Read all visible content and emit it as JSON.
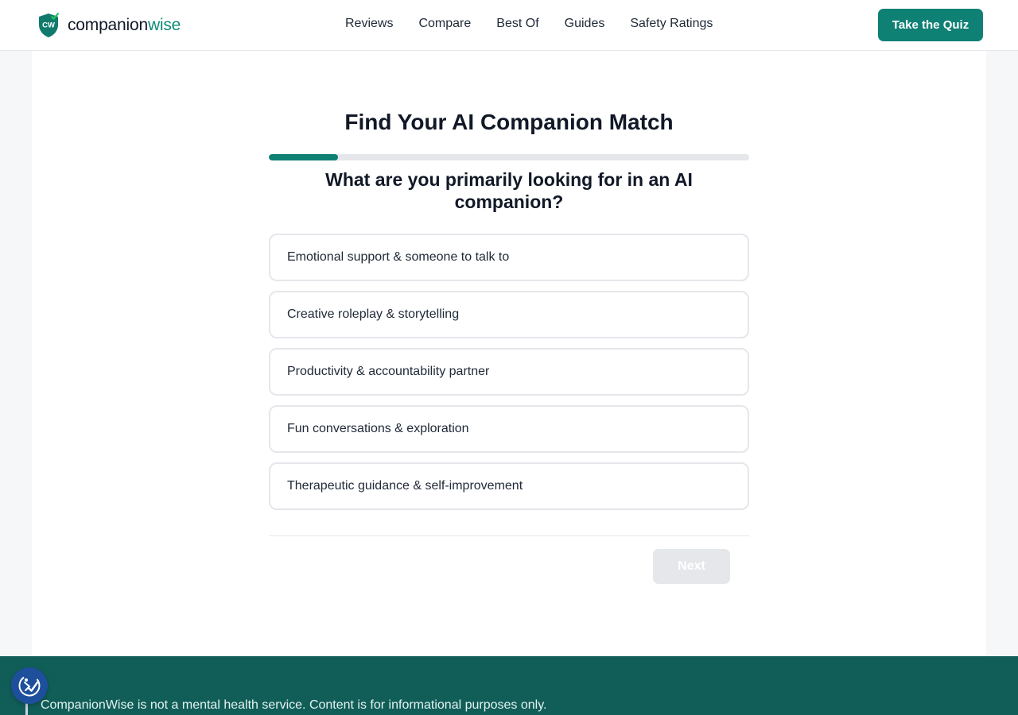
{
  "brand": {
    "name_part1": "companion",
    "name_part2": "wise",
    "badge_text": "CW"
  },
  "nav": {
    "items": [
      "Reviews",
      "Compare",
      "Best Of",
      "Guides",
      "Safety Ratings"
    ]
  },
  "header": {
    "cta_label": "Take the Quiz"
  },
  "quiz": {
    "title": "Find Your AI Companion Match",
    "progress_fraction": 0.144,
    "question": "What are you primarily looking for in an AI companion?",
    "options": [
      "Emotional support & someone to talk to",
      "Creative roleplay & storytelling",
      "Productivity & accountability partner",
      "Fun conversations & exploration",
      "Therapeutic guidance & self-improvement"
    ],
    "next_label": "Next"
  },
  "footer": {
    "disclaimer": "CompanionWise is not a mental health service. Content is for informational purposes only."
  },
  "icons": {
    "accessibility": "accessibility-check-icon",
    "logo": "shield-check-icon"
  },
  "colors": {
    "accent": "#0f8074",
    "footer": "#115e59",
    "a11y": "#1d4f9c",
    "disabled": "#e5e7eb"
  }
}
